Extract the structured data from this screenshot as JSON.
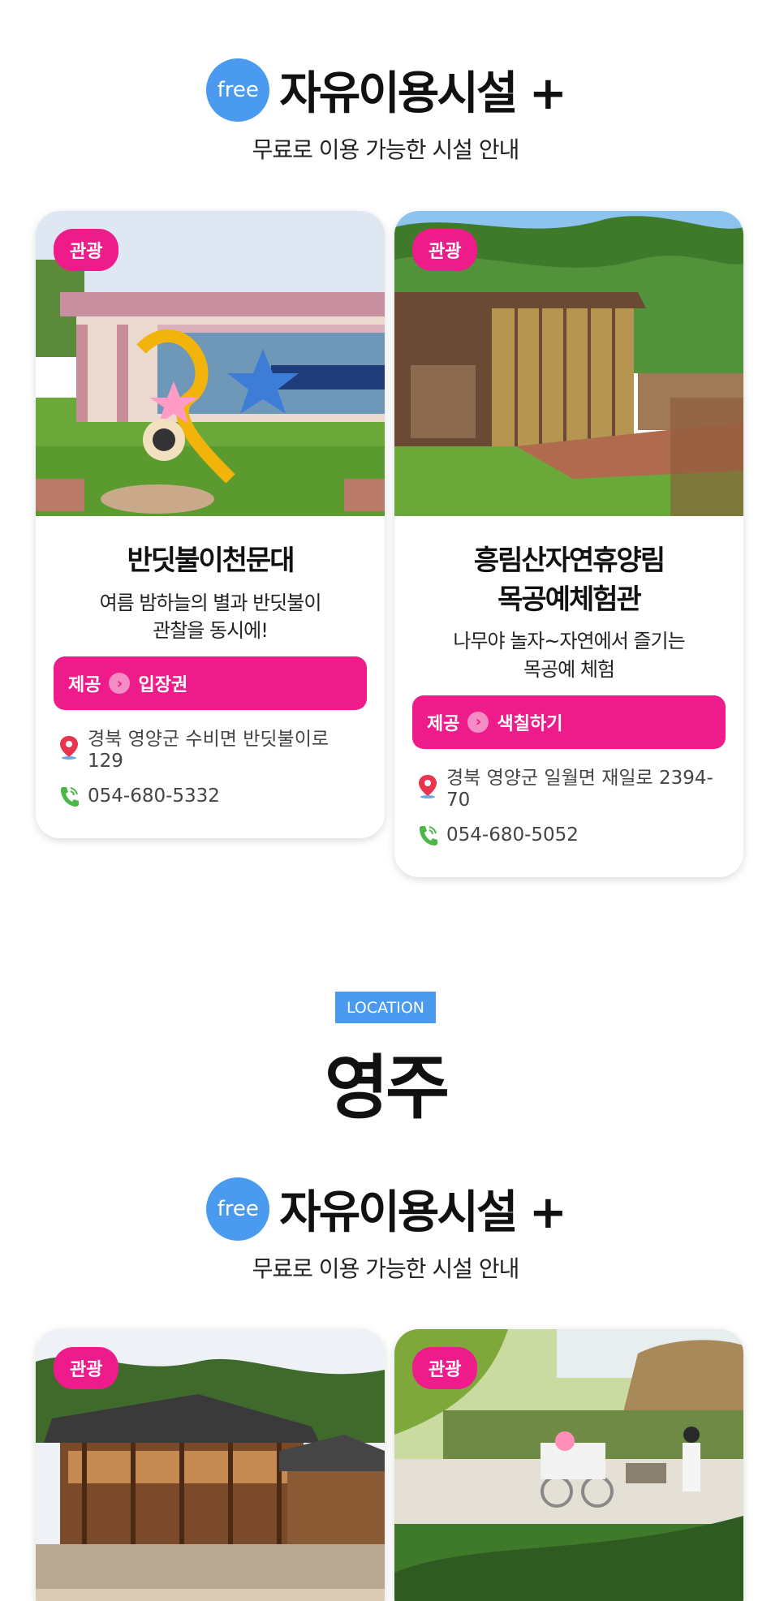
{
  "section1": {
    "free_badge": "free",
    "title": "자유이용시설 +",
    "subtitle": "무료로 이용 가능한 시설 안내"
  },
  "cards1": [
    {
      "tag": "관광",
      "name": "반딧불이천문대",
      "desc": "여름 밤하늘의 별과 반딧불이\n관찰을 동시에!",
      "provide_label": "제공",
      "provide_value": "입장권",
      "address": "경북 영양군 수비면 반딧불이로 129",
      "phone": "054-680-5332"
    },
    {
      "tag": "관광",
      "name": "흥림산자연휴양림\n목공예체험관",
      "desc": "나무야 놀자~자연에서 즐기는\n목공예 체험",
      "provide_label": "제공",
      "provide_value": "색칠하기",
      "address": "경북 영양군 일월면 재일로 2394-70",
      "phone": "054-680-5052"
    }
  ],
  "location": {
    "label": "LOCATION",
    "city": "영주"
  },
  "section2": {
    "free_badge": "free",
    "title": "자유이용시설 +",
    "subtitle": "무료로 이용 가능한 시설 안내"
  },
  "cards2": [
    {
      "tag": "관광"
    },
    {
      "tag": "관광"
    }
  ],
  "colors": {
    "accent_pink": "#ee1c8a",
    "accent_blue": "#4a9bf0",
    "pin_red": "#e8344e",
    "phone_green": "#4cb848"
  },
  "icons": [
    "location-pin-icon",
    "phone-icon",
    "chevron-right-icon"
  ]
}
